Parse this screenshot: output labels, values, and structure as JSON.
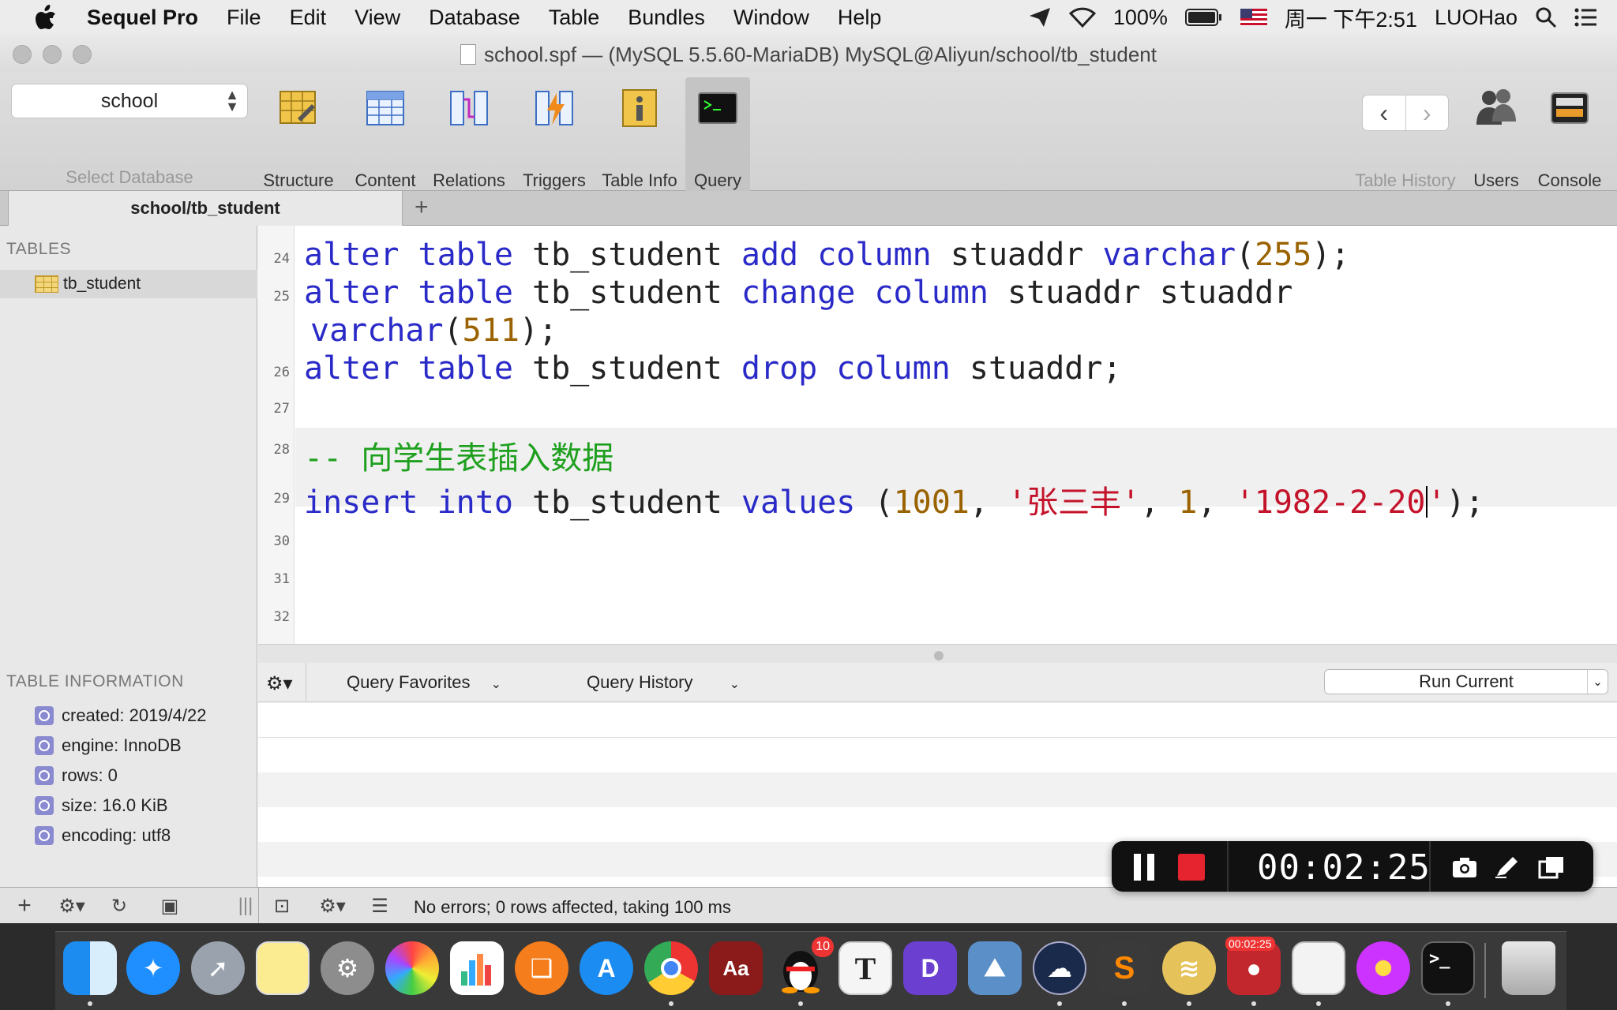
{
  "menubar": {
    "app_name": "Sequel Pro",
    "items": [
      "File",
      "Edit",
      "View",
      "Database",
      "Table",
      "Bundles",
      "Window",
      "Help"
    ],
    "battery": "100%",
    "clock": "周一 下午2:51",
    "user": "LUOHao"
  },
  "window": {
    "title": "school.spf — (MySQL 5.5.60-MariaDB) MySQL@Aliyun/school/tb_student"
  },
  "toolbar": {
    "database": "school",
    "database_caption": "Select Database",
    "buttons": {
      "structure": "Structure",
      "content": "Content",
      "relations": "Relations",
      "triggers": "Triggers",
      "table_info": "Table Info",
      "query": "Query",
      "table_history": "Table History",
      "users": "Users",
      "console": "Console"
    }
  },
  "tab": {
    "label": "school/tb_student",
    "add": "+"
  },
  "sidebar": {
    "tables_header": "TABLES",
    "table": "tb_student",
    "info_header": "TABLE INFORMATION",
    "info": [
      "created: 2019/4/22",
      "engine: InnoDB",
      "rows: 0",
      "size: 16.0 KiB",
      "encoding: utf8"
    ]
  },
  "editor": {
    "line_numbers": [
      "24",
      "25",
      "26",
      "27",
      "28",
      "29",
      "30",
      "31",
      "32"
    ],
    "lines": {
      "l24": {
        "kw1": "alter table",
        "t1": " tb_student ",
        "kw2": "add column",
        "t2": " stuaddr ",
        "kw3": "varchar",
        "p1": "(",
        "n1": "255",
        "p2": ");"
      },
      "l25a": {
        "kw1": "alter table",
        "t1": " tb_student ",
        "kw2": "change column",
        "t2": " stuaddr stuaddr"
      },
      "l25b": {
        "kw1": "varchar",
        "p1": "(",
        "n1": "511",
        "p2": ");"
      },
      "l26": {
        "kw1": "alter table",
        "t1": " tb_student ",
        "kw2": "drop column",
        "t2": " stuaddr;"
      },
      "l28": {
        "cmt": "-- 向学生表插入数据"
      },
      "l29": {
        "kw1": "insert into",
        "t1": " tb_student ",
        "kw2": "values",
        "p1": " (",
        "n1": "1001",
        "c1": ", ",
        "s1": "'张三丰'",
        "c2": ", ",
        "n2": "1",
        "c3": ", ",
        "s2a": "'1982-2-20",
        "s2b": "'",
        "p2": ");"
      }
    }
  },
  "query_bar": {
    "favorites": "Query Favorites",
    "history": "Query History",
    "run": "Run Current"
  },
  "status": {
    "message": "No errors; 0 rows affected, taking 100 ms"
  },
  "recorder": {
    "time": "00:02:25"
  },
  "dock": {
    "qq_badge": "10",
    "recorder_badge": "00:02:25",
    "typora_letter": "T",
    "dict_letter": "Aa"
  },
  "colors": {
    "keyword": "#2a2ac8",
    "number": "#9a6200",
    "string": "#c4122a",
    "comment": "#1ea01e"
  }
}
